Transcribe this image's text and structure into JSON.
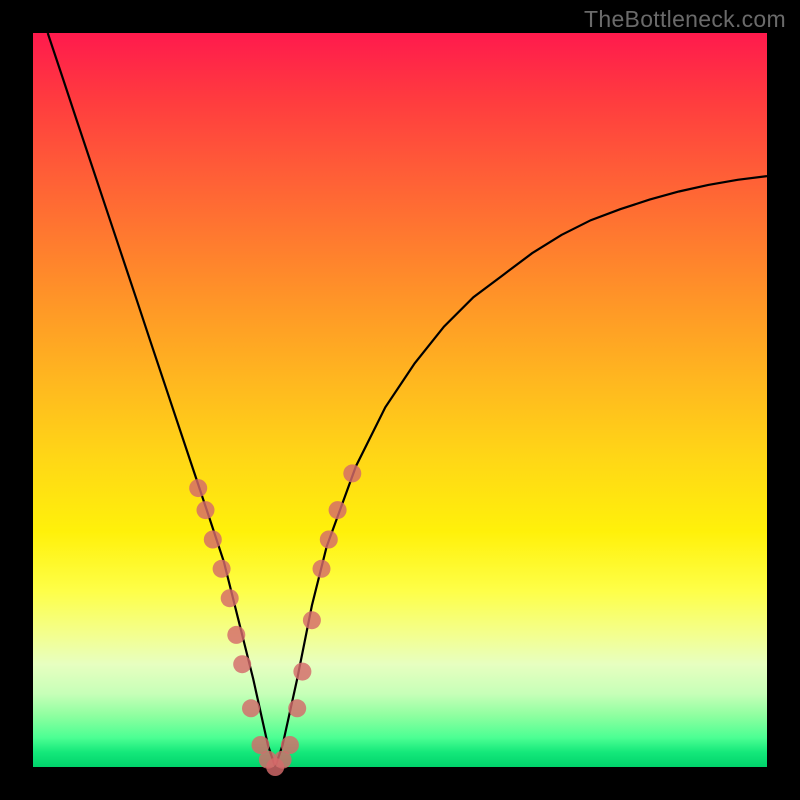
{
  "watermark": "TheBottleneck.com",
  "colors": {
    "frame": "#000000",
    "curve": "#000000",
    "marker": "#d46a6a"
  },
  "chart_data": {
    "type": "line",
    "title": "",
    "xlabel": "",
    "ylabel": "",
    "xlim": [
      0,
      100
    ],
    "ylim": [
      0,
      100
    ],
    "series": [
      {
        "name": "bottleneck-curve",
        "x": [
          2,
          4,
          6,
          8,
          10,
          12,
          14,
          16,
          18,
          20,
          22,
          24,
          26,
          28,
          30,
          32,
          33,
          34,
          36,
          38,
          40,
          44,
          48,
          52,
          56,
          60,
          64,
          68,
          72,
          76,
          80,
          84,
          88,
          92,
          96,
          100
        ],
        "y": [
          100,
          94,
          88,
          82,
          76,
          70,
          64,
          58,
          52,
          46,
          40,
          34,
          28,
          20,
          12,
          3,
          0,
          3,
          12,
          22,
          30,
          41,
          49,
          55,
          60,
          64,
          67,
          70,
          72.5,
          74.5,
          76,
          77.3,
          78.4,
          79.3,
          80,
          80.5
        ]
      }
    ],
    "markers": {
      "name": "highlighted-points",
      "x": [
        22.5,
        23.5,
        24.5,
        25.7,
        26.8,
        27.7,
        28.5,
        29.7,
        31,
        32,
        33,
        34,
        35,
        36,
        36.7,
        38,
        39.3,
        40.3,
        41.5,
        43.5
      ],
      "y": [
        38,
        35,
        31,
        27,
        23,
        18,
        14,
        8,
        3,
        1,
        0,
        1,
        3,
        8,
        13,
        20,
        27,
        31,
        35,
        40
      ]
    },
    "annotations": []
  }
}
